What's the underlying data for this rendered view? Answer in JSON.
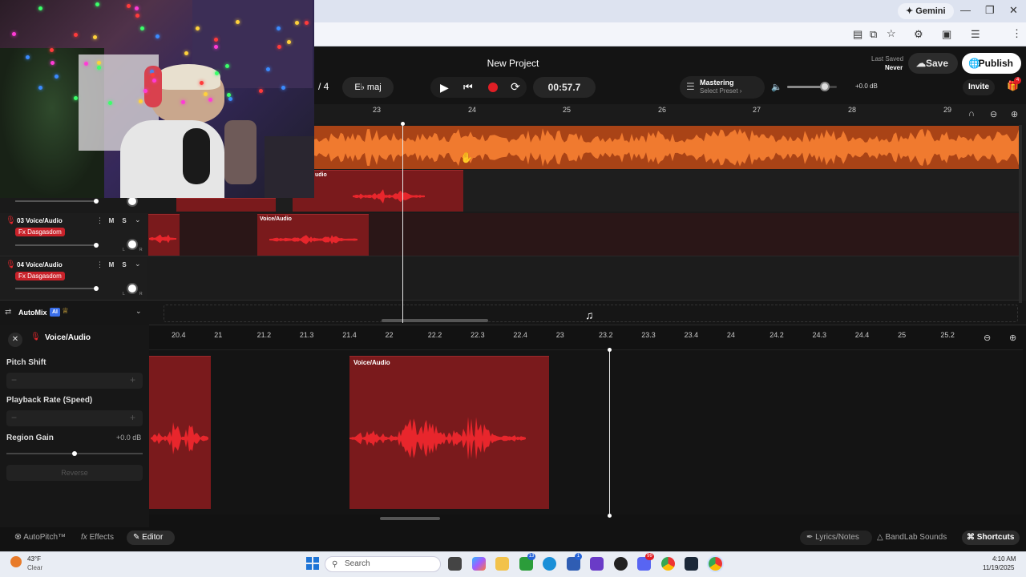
{
  "browser": {
    "gemini_label": "Gemini"
  },
  "header": {
    "project_title": "New Project",
    "bars_value": "4",
    "key": "E♭ maj",
    "time": "00:57.7",
    "mastering_title": "Mastering",
    "mastering_preset": "Select Preset",
    "volume_db": "+0.0 dB",
    "last_saved_label": "Last Saved",
    "last_saved_value": "Never",
    "save_label": "Save",
    "publish_label": "Publish",
    "invite_label": "Invite",
    "gift_badge": "4",
    "volume_level": 0.75
  },
  "ruler": {
    "marks": [
      "23",
      "24",
      "25",
      "26",
      "27",
      "28",
      "29"
    ]
  },
  "tracks": [
    {
      "number": "03",
      "name": "Voice/Audio",
      "fx": "Fx Dasgasdom",
      "mute": "M",
      "solo": "S",
      "knob_left": "L",
      "knob_right": "R"
    },
    {
      "number": "04",
      "name": "Voice/Audio",
      "fx": "Fx Dasgasdom",
      "mute": "M",
      "solo": "S",
      "knob_left": "L",
      "knob_right": "R"
    }
  ],
  "clip_labels": {
    "top_partial": "udio",
    "track3_clip": "Voice/Audio",
    "editor_clip": "Voice/Audio"
  },
  "automix": {
    "label": "AutoMix",
    "badge": "AI"
  },
  "editor": {
    "title": "Voice/Audio",
    "pitch_label": "Pitch Shift",
    "rate_label": "Playback Rate (Speed)",
    "gain_label": "Region Gain",
    "gain_value": "+0.0 dB",
    "reverse_label": "Reverse",
    "minus": "−",
    "plus": "+",
    "ruler": [
      "20.4",
      "21",
      "21.2",
      "21.3",
      "21.4",
      "22",
      "22.2",
      "22.3",
      "22.4",
      "23",
      "23.2",
      "23.3",
      "23.4",
      "24",
      "24.2",
      "24.3",
      "24.4",
      "25",
      "25.2"
    ]
  },
  "bottom_tabs": {
    "autopitch": "AutoPitch™",
    "effects": "Effects",
    "editor": "Editor",
    "lyrics": "Lyrics/Notes",
    "sounds": "BandLab Sounds",
    "shortcuts": "Shortcuts"
  },
  "taskbar": {
    "temperature": "43°F",
    "weather": "Clear",
    "search_placeholder": "Search",
    "time": "4:10 AM",
    "date": "11/19/2025",
    "badge_teams": "13",
    "badge_store": "1",
    "badge_discord": "99"
  },
  "colors": {
    "waveform_orange": "#f06a22",
    "clip_red": "#7a1a1c",
    "wave_red": "#e8262c",
    "accent_red": "#c9222a"
  }
}
